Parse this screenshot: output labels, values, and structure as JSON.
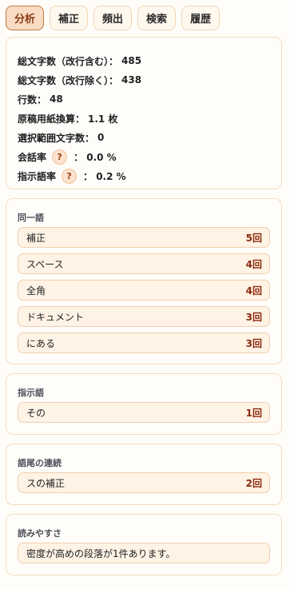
{
  "tabs": [
    {
      "label": "分析",
      "active": true
    },
    {
      "label": "補正",
      "active": false
    },
    {
      "label": "頻出",
      "active": false
    },
    {
      "label": "検索",
      "active": false
    },
    {
      "label": "履歴",
      "active": false
    }
  ],
  "stats": {
    "chars_with_newline": {
      "label": "総文字数（改行含む）：",
      "value": "485"
    },
    "chars_without_newline": {
      "label": "総文字数（改行除く）：",
      "value": "438"
    },
    "lines": {
      "label": "行数：",
      "value": "48"
    },
    "manuscript": {
      "label": "原稿用紙換算：",
      "value": "1.1 枚"
    },
    "selection": {
      "label": "選択範囲文字数：",
      "value": "0"
    },
    "dialogue": {
      "label": "会話率",
      "help": "?",
      "value": "：  0.0 %"
    },
    "demonstrative": {
      "label": "指示語率",
      "help": "?",
      "value": "：  0.2 %"
    }
  },
  "same_words": {
    "title": "同一語",
    "items": [
      {
        "word": "補正",
        "count": "5回"
      },
      {
        "word": "スペース",
        "count": "4回"
      },
      {
        "word": "全角",
        "count": "4回"
      },
      {
        "word": "ドキュメント",
        "count": "3回"
      },
      {
        "word": "にある",
        "count": "3回"
      }
    ]
  },
  "demonstratives": {
    "title": "指示語",
    "items": [
      {
        "word": "その",
        "count": "1回"
      }
    ]
  },
  "ending_repeat": {
    "title": "語尾の連続",
    "items": [
      {
        "word": "スの補正",
        "count": "2回"
      }
    ]
  },
  "readability": {
    "title": "読みやすさ",
    "note": "密度が高めの段落が1件あります。"
  }
}
